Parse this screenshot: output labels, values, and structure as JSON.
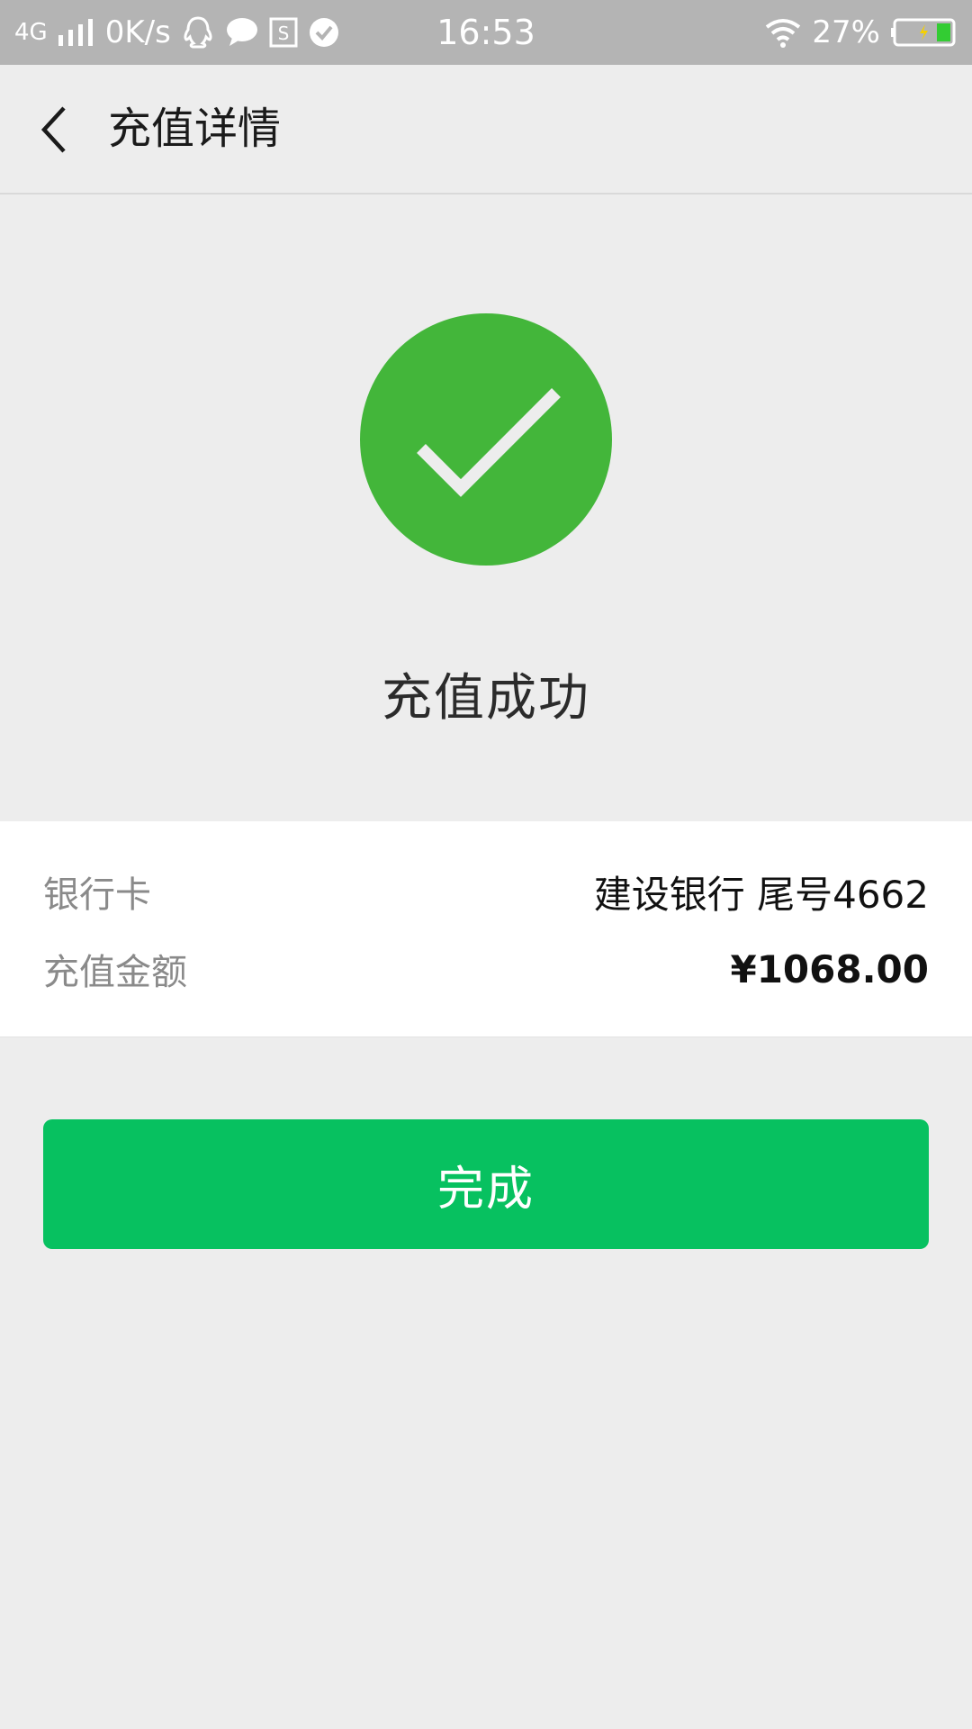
{
  "status_bar": {
    "network": "4G",
    "speed": "0K/s",
    "time": "16:53",
    "battery": "27%",
    "icons": [
      "signal-icon",
      "qq-icon",
      "chat-bubble-icon",
      "s-badge-icon",
      "check-badge-icon",
      "wifi-icon",
      "battery-icon"
    ]
  },
  "nav": {
    "title": "充值详情",
    "back_icon": "chevron-left-icon"
  },
  "result": {
    "icon": "success-check-icon",
    "message": "充值成功"
  },
  "details": {
    "bank_label": "银行卡",
    "bank_value": "建设银行 尾号4662",
    "amount_label": "充值金额",
    "amount_value": "¥1068.00"
  },
  "actions": {
    "done_label": "完成"
  },
  "colors": {
    "status_bar_bg": "#b4b4b4",
    "page_bg": "#ededed",
    "success_green": "#43b63a",
    "button_green": "#07c160",
    "battery_green": "#33cc33"
  }
}
